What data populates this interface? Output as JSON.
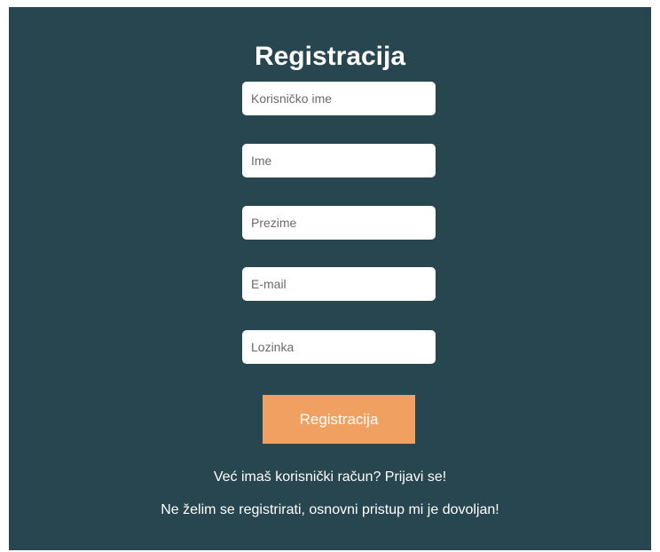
{
  "form": {
    "title": "Registracija",
    "fields": {
      "username": {
        "placeholder": "Korisničko ime"
      },
      "first_name": {
        "placeholder": "Ime"
      },
      "last_name": {
        "placeholder": "Prezime"
      },
      "email": {
        "placeholder": "E-mail"
      },
      "password": {
        "placeholder": "Lozinka"
      }
    },
    "submit_label": "Registracija",
    "login_link": "Već imaš korisnički račun? Prijavi se!",
    "skip_link": "Ne želim se registrirati, osnovni pristup mi je dovoljan!"
  },
  "colors": {
    "panel_background": "#27464f",
    "button_background": "#f0a060",
    "text": "#ffffff"
  }
}
